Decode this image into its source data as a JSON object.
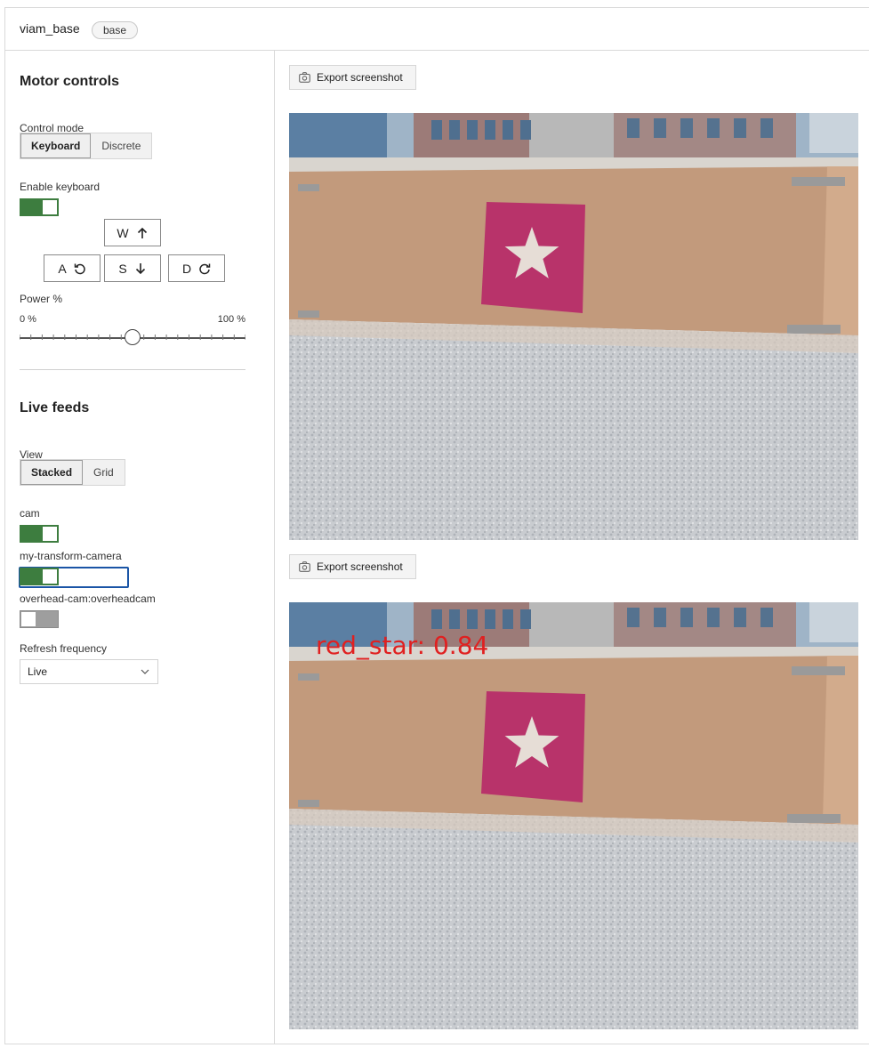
{
  "header": {
    "title": "viam_base",
    "badge": "base"
  },
  "motor_controls": {
    "title": "Motor controls",
    "control_mode_label": "Control mode",
    "control_mode_options": [
      "Keyboard",
      "Discrete"
    ],
    "control_mode_selected": "Keyboard",
    "enable_keyboard_label": "Enable keyboard",
    "enable_keyboard": true,
    "keys": {
      "w": "W",
      "a": "A",
      "s": "S",
      "d": "D"
    },
    "power_label": "Power %",
    "power_min_label": "0 %",
    "power_max_label": "100 %",
    "power_value_percent": 50
  },
  "live_feeds": {
    "title": "Live feeds",
    "view_label": "View",
    "view_options": [
      "Stacked",
      "Grid"
    ],
    "view_selected": "Stacked",
    "cameras": [
      {
        "name": "cam",
        "enabled": true
      },
      {
        "name": "my-transform-camera",
        "enabled": true
      },
      {
        "name": "overhead-cam:overheadcam",
        "enabled": false
      }
    ],
    "refresh_label": "Refresh frequency",
    "refresh_value": "Live"
  },
  "feeds": [
    {
      "export_label": "Export screenshot",
      "overlay_text": ""
    },
    {
      "export_label": "Export screenshot",
      "overlay_text": "red_star: 0.84"
    }
  ],
  "colors": {
    "toggle_on": "#3d7d3f",
    "toggle_off": "#9e9e9e",
    "focus": "#1a55a6",
    "overlay": "#e02020",
    "star_card": "#b8336a"
  }
}
